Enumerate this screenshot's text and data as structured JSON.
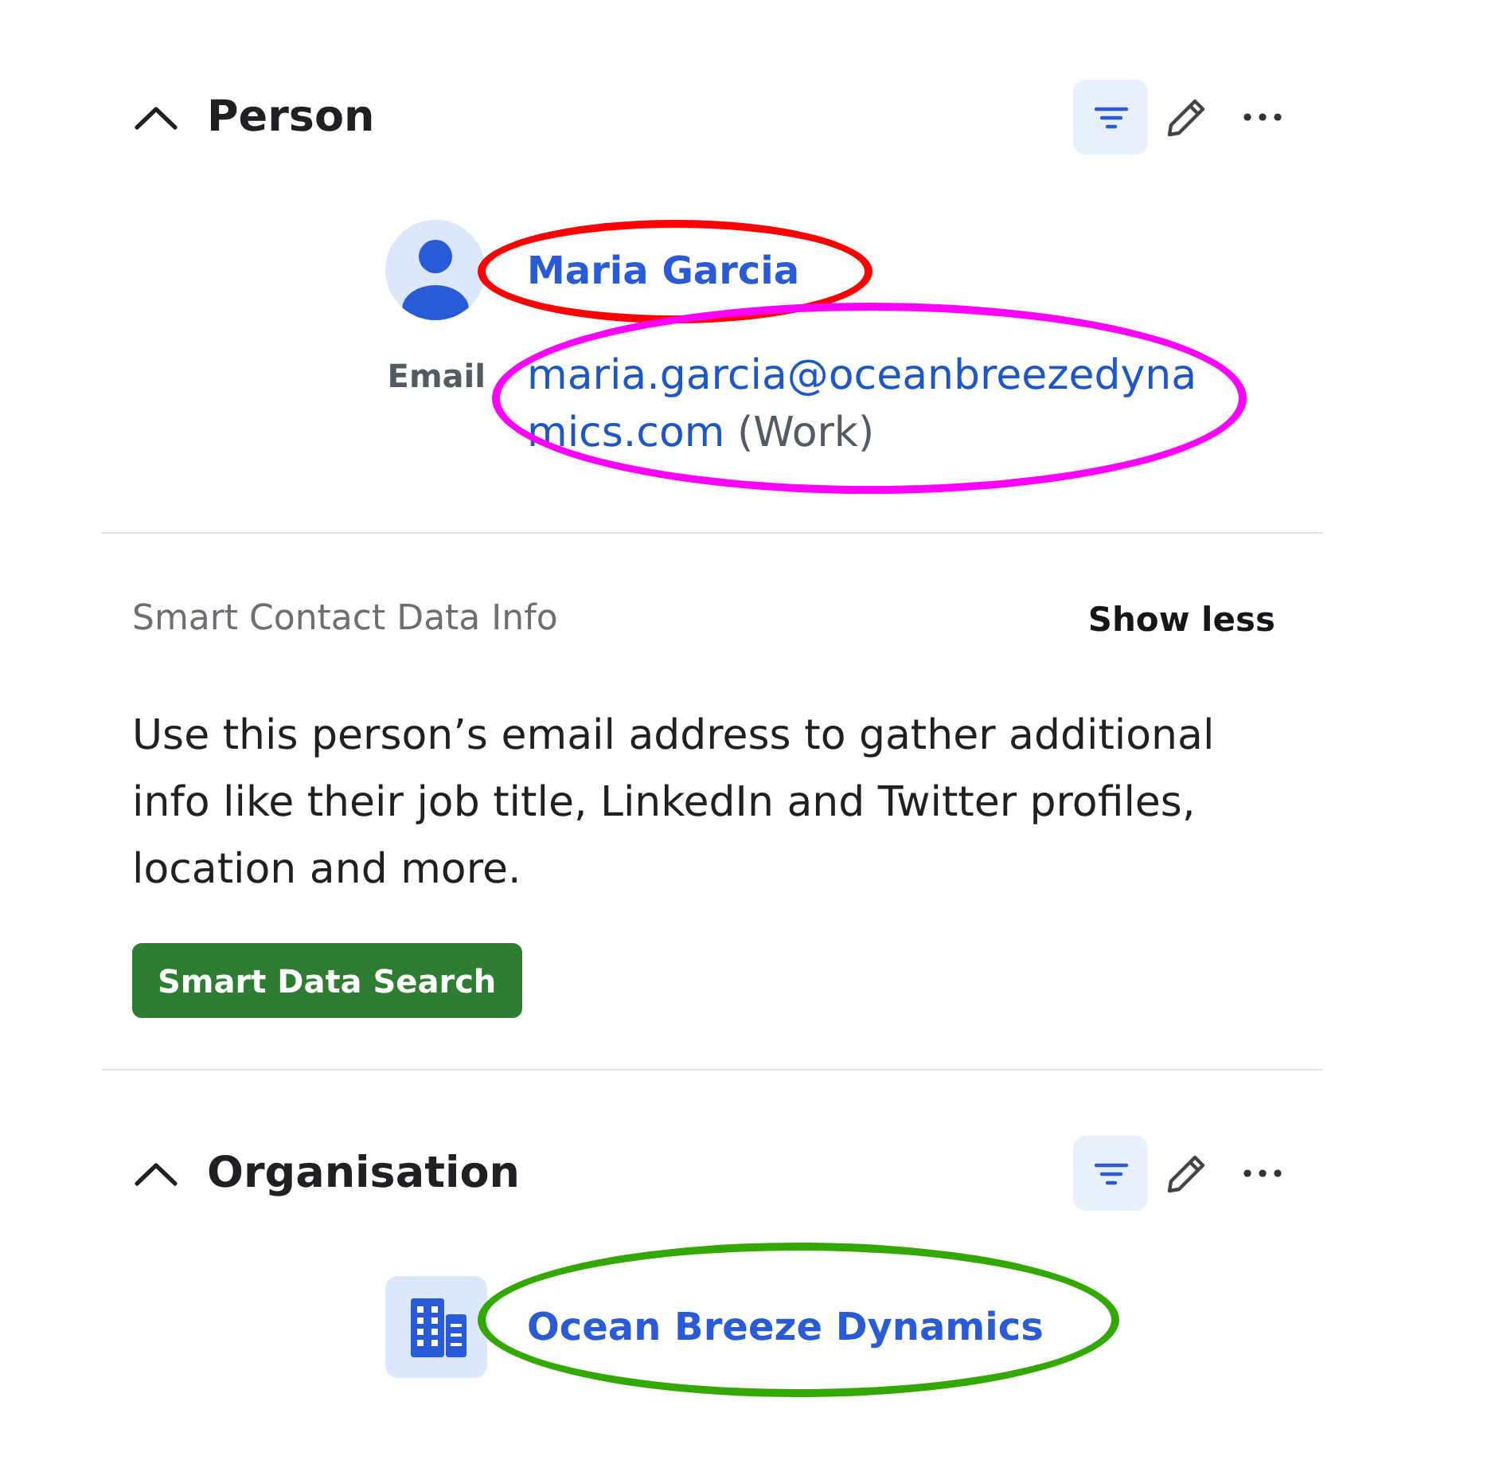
{
  "sections": [
    {
      "kind": "person",
      "title": "Person",
      "expanded": true,
      "filter_on": true,
      "contact": {
        "name": {
          "text": "Maria Garcia",
          "annotation": {
            "kind": "ellipse",
            "color": "#ff0000"
          }
        },
        "fields": [
          {
            "label": "Email",
            "value": "maria.garcia@oceanbreezedynamics.com",
            "type": "(Work)",
            "annotation": {
              "kind": "ellipse",
              "color": "#ff00ff"
            }
          }
        ]
      },
      "smart_info": {
        "title": "Smart Contact Data Info",
        "toggle": "Show less",
        "description": "Use this person’s email address to gather additional info like their job title, LinkedIn and Twitter profiles, location and more.",
        "button": "Smart Data Search"
      }
    },
    {
      "kind": "organisation",
      "title": "Organisation",
      "expanded": true,
      "filter_on": true,
      "organisation": {
        "name": {
          "text": "Ocean Breeze Dynamics",
          "annotation": {
            "kind": "ellipse",
            "color": "#33a800"
          }
        }
      }
    }
  ]
}
